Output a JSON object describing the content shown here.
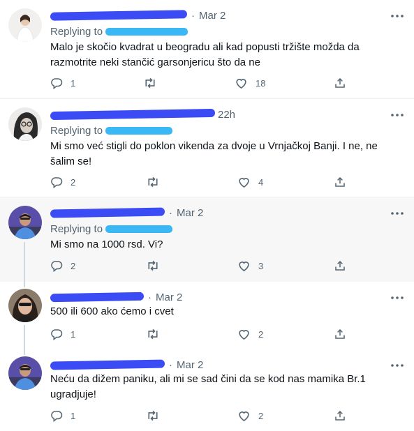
{
  "colors": {
    "text": "#0f1419",
    "secondary": "#536471",
    "redact_name": "#3c4cf5",
    "redact_handle": "#3ab7f5",
    "highlight_bg": "#f7f7f7",
    "thread_line": "#cfd9de"
  },
  "icons": {
    "more": "more-dots-icon",
    "reply": "reply-icon",
    "retweet": "retweet-icon",
    "like": "heart-icon",
    "share": "share-icon"
  },
  "reply_prefix": "Replying to",
  "tweets": [
    {
      "time": "Mar 2",
      "replying": true,
      "text": "Malo je skočio kvadrat u beogradu ali kad popusti tržište možda da razmotrite neki stančić garsonjericu što da ne",
      "replies": "1",
      "retweets": "",
      "likes": "18"
    },
    {
      "time": "22h",
      "replying": true,
      "text": "Mi smo već stigli do poklon vikenda za dvoje u Vrnjačkoj Banji. I ne, ne šalim se!",
      "replies": "2",
      "retweets": "",
      "likes": "4"
    },
    {
      "time": "Mar 2",
      "replying": true,
      "text": "Mi smo na 1000 rsd. Vi?",
      "replies": "2",
      "retweets": "",
      "likes": "3"
    },
    {
      "time": "Mar 2",
      "replying": false,
      "text": "500 ili 600 ako ćemo i cvet",
      "replies": "1",
      "retweets": "",
      "likes": "2"
    },
    {
      "time": "Mar 2",
      "replying": false,
      "text": "Neću da dižem paniku, ali mi se sad čini da se kod nas mamika Br.1 ugradjuje!",
      "replies": "1",
      "retweets": "",
      "likes": "2"
    }
  ]
}
